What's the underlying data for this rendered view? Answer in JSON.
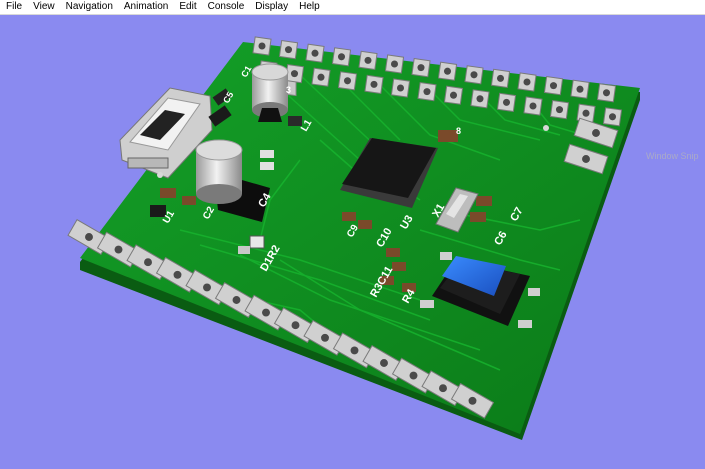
{
  "menubar": {
    "items": [
      {
        "label": "File"
      },
      {
        "label": "View"
      },
      {
        "label": "Navigation"
      },
      {
        "label": "Animation"
      },
      {
        "label": "Edit"
      },
      {
        "label": "Console"
      },
      {
        "label": "Display"
      },
      {
        "label": "Help"
      }
    ]
  },
  "viewport": {
    "background_color": "#8a8af0",
    "board_color": "#0f8a1e",
    "watermark": "Window Snip"
  },
  "pcb": {
    "refdes": {
      "c5": "C5",
      "c1": "C1",
      "l1": "L1",
      "c3": "3",
      "c4": "C4",
      "u1": "U1",
      "c2": "C2",
      "d1r2": "D1R2",
      "c9": "C9",
      "c10": "C10",
      "u3": "U3",
      "x1": "X1",
      "c6": "C6",
      "c7": "C7",
      "c11": "R3C11",
      "r4": "R4",
      "c8": "8"
    }
  }
}
